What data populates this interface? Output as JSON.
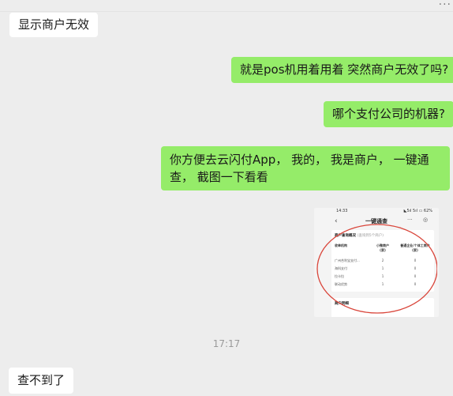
{
  "top_more": "···",
  "messages": [
    {
      "side": "in",
      "text": "显示商户无效"
    },
    {
      "side": "out",
      "text": "就是pos机用着用着 突然商户无效了吗?"
    },
    {
      "side": "out",
      "text": "哪个支付公司的机器?"
    },
    {
      "side": "out",
      "text": "你方便去云闪付App， 我的， 我是商户， 一键通查， 截图一下看看"
    },
    {
      "side": "in",
      "text": "查不到了"
    }
  ],
  "timestamp": "17:17",
  "screenshot": {
    "status_time": "14:33",
    "status_signal": "◣5ıl 5ıl ▭ 62%",
    "back": "‹",
    "title": "一键通查",
    "more": "···",
    "target": "◎",
    "section1_title": "商户查询概况",
    "section1_sub": "(查询到5个商户)",
    "table_headers": [
      "收单机构",
      "小微商户(家)",
      "普通企业/个体工商户(家)"
    ],
    "table_rows": [
      [
        "广州合利宝支付...",
        "2",
        "0"
      ],
      [
        "海科支付",
        "1",
        "0"
      ],
      [
        "拉卡拉",
        "1",
        "0"
      ],
      [
        "联动优势",
        "1",
        "0"
      ]
    ],
    "section2_title": "商户明细"
  },
  "colors": {
    "background": "#ededed",
    "outgoing_bubble": "#95ec69",
    "incoming_bubble": "#ffffff",
    "annotation_ring": "#d9453a"
  }
}
